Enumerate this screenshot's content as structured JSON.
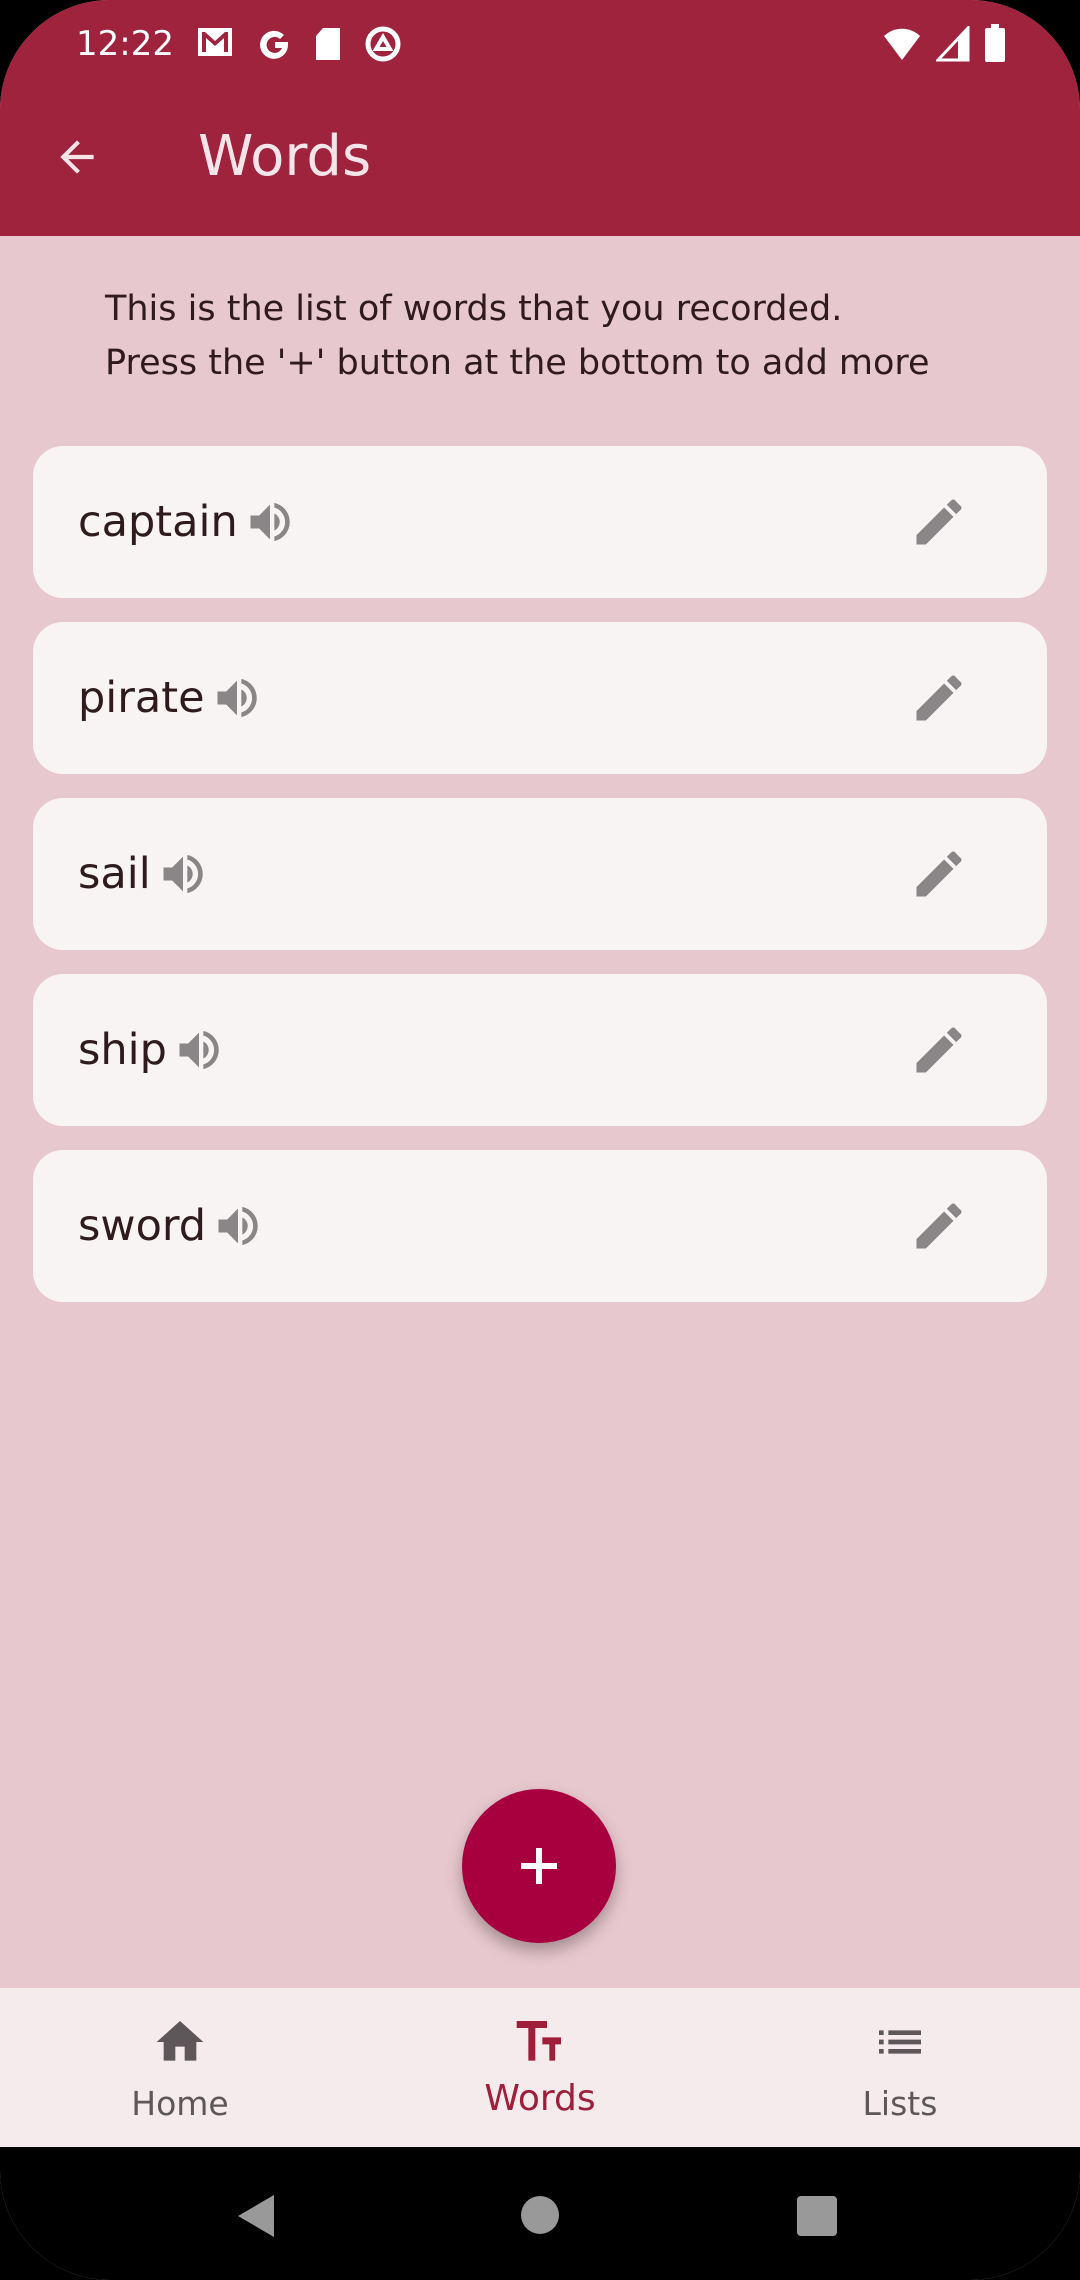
{
  "status_bar": {
    "time": "12:22",
    "icons": [
      "gmail-icon",
      "google-icon",
      "sd-card-icon",
      "vpn-icon",
      "wifi-icon",
      "signal-icon",
      "battery-icon"
    ]
  },
  "app_bar": {
    "title": "Words",
    "back_icon": "arrow-back-icon"
  },
  "description": {
    "line1": "This is the list of words that you recorded.",
    "line2": "Press the '+' button at the bottom to add more"
  },
  "words": [
    {
      "label": "captain"
    },
    {
      "label": "pirate"
    },
    {
      "label": "sail"
    },
    {
      "label": "ship"
    },
    {
      "label": "sword"
    }
  ],
  "fab": {
    "label": "+"
  },
  "bottom_nav": {
    "items": [
      {
        "label": "Home",
        "icon": "home-icon"
      },
      {
        "label": "Words",
        "icon": "text-fields-icon",
        "active": true
      },
      {
        "label": "Lists",
        "icon": "list-icon"
      }
    ]
  },
  "colors": {
    "primary": "#9f233c",
    "background": "#e8c8cf",
    "card": "#f9f4f4",
    "fab": "#a8003f",
    "active_nav": "#9f1e3a"
  }
}
